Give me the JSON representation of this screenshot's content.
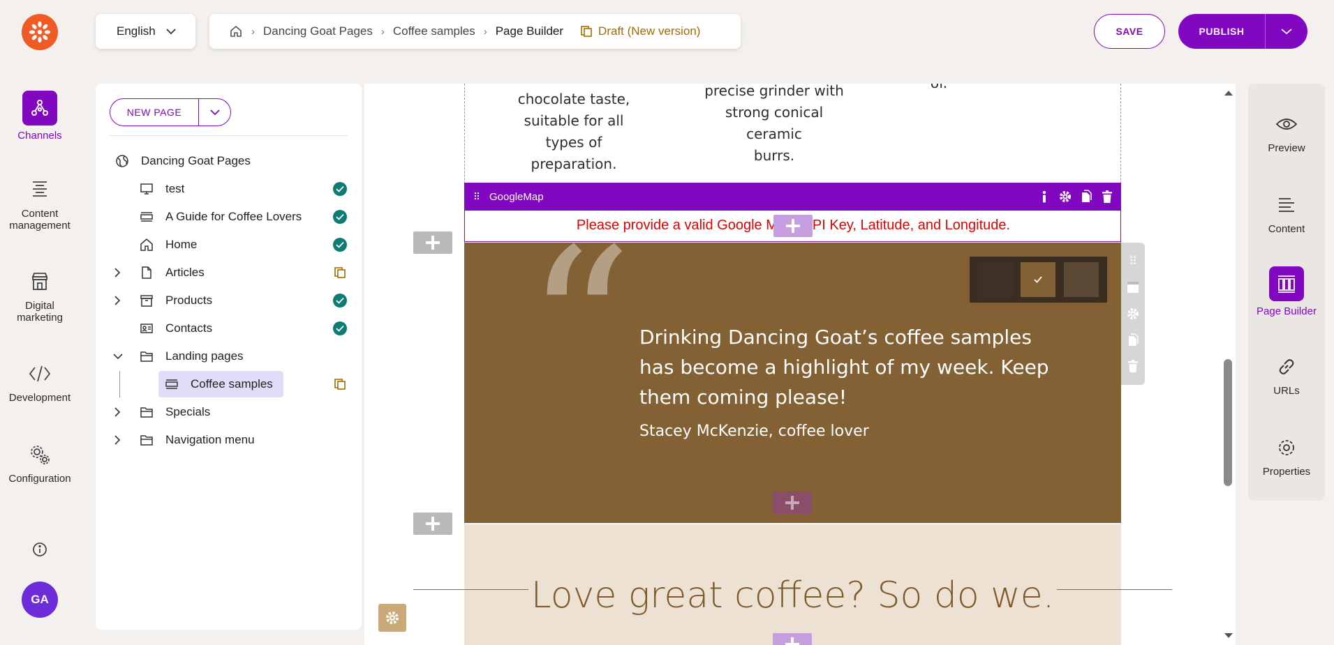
{
  "language": {
    "selected": "English"
  },
  "breadcrumb": {
    "items": [
      "Dancing Goat Pages",
      "Coffee samples"
    ],
    "current": "Page Builder",
    "status": "Draft (New version)"
  },
  "actions": {
    "save": "SAVE",
    "publish": "PUBLISH"
  },
  "rail": {
    "channels": "Channels",
    "content_management_1": "Content",
    "content_management_2": "management",
    "digital_marketing_1": "Digital",
    "digital_marketing_2": "marketing",
    "development": "Development",
    "configuration": "Configuration",
    "avatar_initials": "GA"
  },
  "tree": {
    "new_page": "NEW PAGE",
    "root": "Dancing Goat Pages",
    "nodes": {
      "test": "test",
      "guide": "A Guide for Coffee Lovers",
      "home": "Home",
      "articles": "Articles",
      "products": "Products",
      "contacts": "Contacts",
      "landing": "Landing pages",
      "coffee_samples": "Coffee samples",
      "specials": "Specials",
      "navigation": "Navigation menu"
    }
  },
  "canvas": {
    "feature_1": [
      "chocolate taste,",
      "suitable for all types of",
      "preparation."
    ],
    "feature_2": [
      "precise grinder with",
      "strong conical ceramic",
      "burrs."
    ],
    "feature_3": "of.",
    "widget_name": "GoogleMap",
    "map_error": "Please provide a valid Google Maps API Key, Latitude, and Longitude.",
    "quote": "Drinking Dancing Goat’s coffee samples has become a highlight of my week. Keep them coming please!",
    "quote_author": "Stacey McKenzie, coffee lover",
    "love_title": "Love great coffee? So do we."
  },
  "right_panel": {
    "preview": "Preview",
    "content": "Content",
    "page_builder": "Page Builder",
    "urls": "URLs",
    "properties": "Properties"
  },
  "colors": {
    "accent": "#8107c1",
    "brand_orange": "#f15a24",
    "status_published": "#0e7c72",
    "status_draft": "#a66a00",
    "testimonial_bg": "#846134",
    "error": "#e30000"
  }
}
